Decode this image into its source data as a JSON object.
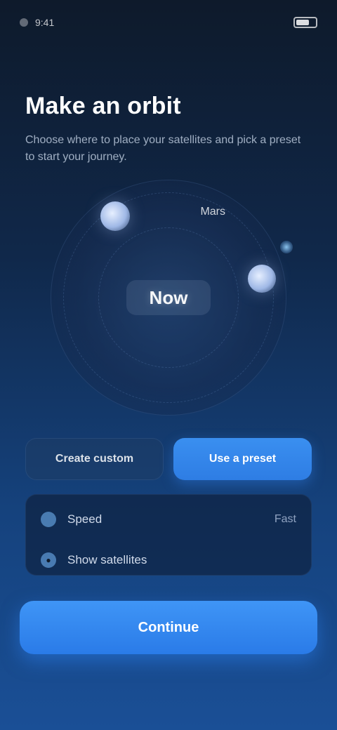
{
  "status": {
    "time": "9:41",
    "carrier": "",
    "battery_label": ""
  },
  "header": {
    "title": "Make an orbit",
    "subtitle": "Choose where to place your satellites and pick a preset to start your journey."
  },
  "orbit": {
    "center_label": "Now",
    "planet_label": "Mars",
    "planet_left_icon": "planet-icon",
    "planet_right_icon": "planet-icon",
    "star_icon": "star-icon"
  },
  "segments": {
    "items": [
      {
        "label": "Create custom"
      },
      {
        "label": "Use a preset"
      }
    ],
    "active_index": 1
  },
  "options": {
    "rows": [
      {
        "label": "Speed",
        "value": "Fast",
        "icon": "dot-icon"
      },
      {
        "label": "Show satellites",
        "value": "",
        "icon": "satellite-icon"
      }
    ]
  },
  "cta": {
    "label": "Continue"
  },
  "colors": {
    "accent": "#2e7de4",
    "cta": "#3f95f6",
    "background_top": "#0e1a2b",
    "background_bottom": "#1a4f96"
  }
}
